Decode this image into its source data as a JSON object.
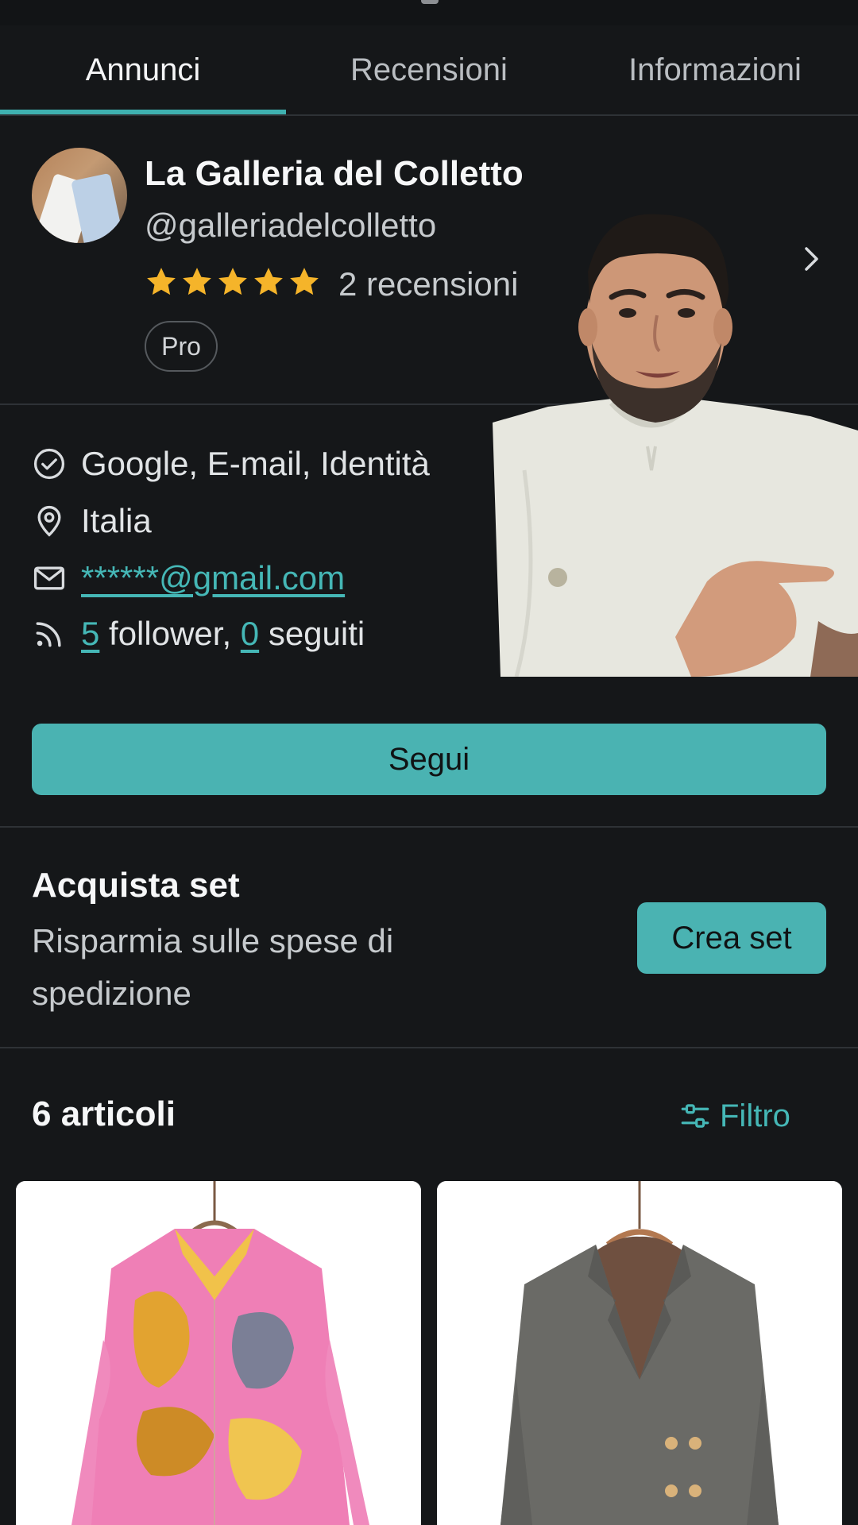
{
  "tabs": [
    {
      "label": "Annunci",
      "active": true
    },
    {
      "label": "Recensioni",
      "active": false
    },
    {
      "label": "Informazioni",
      "active": false
    }
  ],
  "profile": {
    "name": "La Galleria del Colletto",
    "handle": "@galleriadelcolletto",
    "rating": 5,
    "reviews_label": "2 recensioni",
    "badge": "Pro"
  },
  "info": {
    "verified": "Google, E-mail, Identità",
    "location": "Italia",
    "email": "******@gmail.com",
    "followers_count": "5",
    "followers_label": "follower,",
    "following_count": "0",
    "following_label": "seguiti"
  },
  "follow_button": "Segui",
  "bundle": {
    "title": "Acquista set",
    "subtitle": "Risparmia sulle spese di spedizione",
    "button": "Crea set"
  },
  "items": {
    "count_label": "6 articoli",
    "filter_label": "Filtro",
    "cards": [
      {
        "icon": "patterned-shirt"
      },
      {
        "icon": "grey-blazer"
      }
    ]
  },
  "colors": {
    "background": "#151719",
    "accent": "#4ab3b2",
    "star": "#f5b42a",
    "link": "#45b7b6"
  }
}
